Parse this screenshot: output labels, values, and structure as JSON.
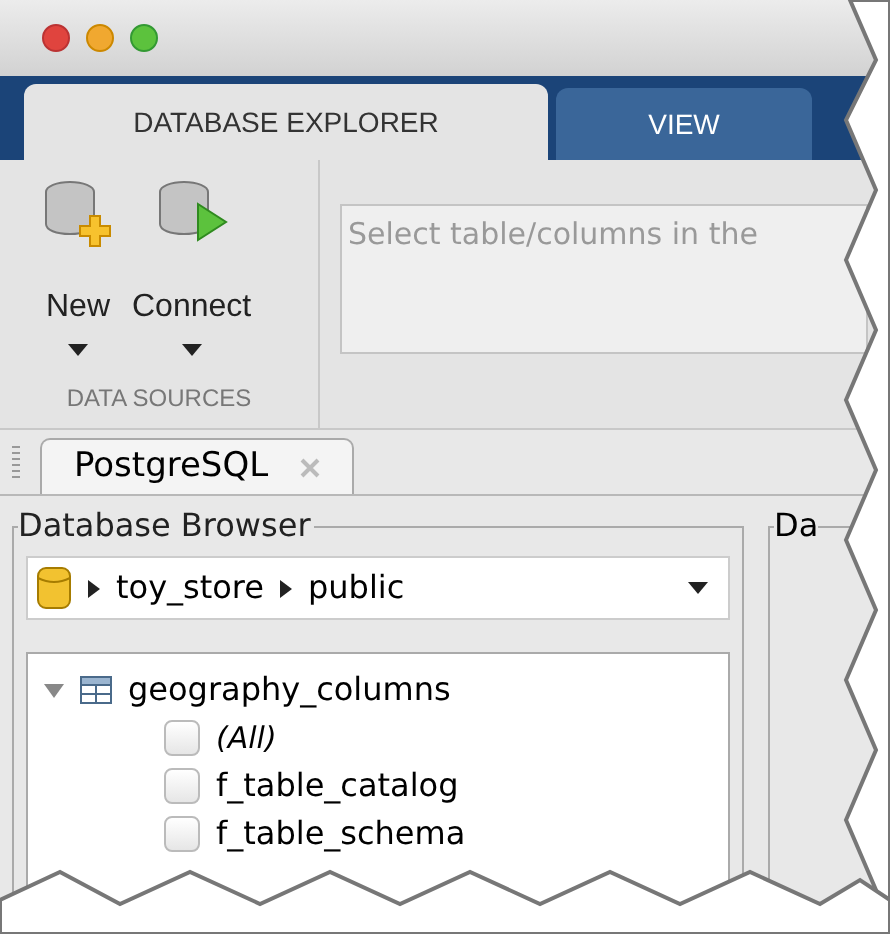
{
  "tabs": [
    {
      "label": "DATABASE EXPLORER",
      "selected": true
    },
    {
      "label": "VIEW",
      "selected": false
    }
  ],
  "toolbar": {
    "buttons": [
      {
        "label": "New",
        "kind": "new"
      },
      {
        "label": "Connect",
        "kind": "connect"
      }
    ],
    "group_label": "DATA SOURCES",
    "query": {
      "placeholder": "Select table/columns in the"
    }
  },
  "document_tabs": [
    {
      "label": "PostgreSQL",
      "selected": true
    }
  ],
  "browser": {
    "title": "Database Browser",
    "path": [
      "toy_store",
      "public"
    ],
    "tree": [
      {
        "label": "geography_columns",
        "expanded": true,
        "children": [
          {
            "label": "(All)",
            "kind": "all",
            "checked": false
          },
          {
            "label": "f_table_catalog",
            "kind": "column",
            "checked": false
          },
          {
            "label": "f_table_schema",
            "kind": "column",
            "checked": false
          }
        ]
      }
    ]
  },
  "right_panel": {
    "title": "Da"
  }
}
